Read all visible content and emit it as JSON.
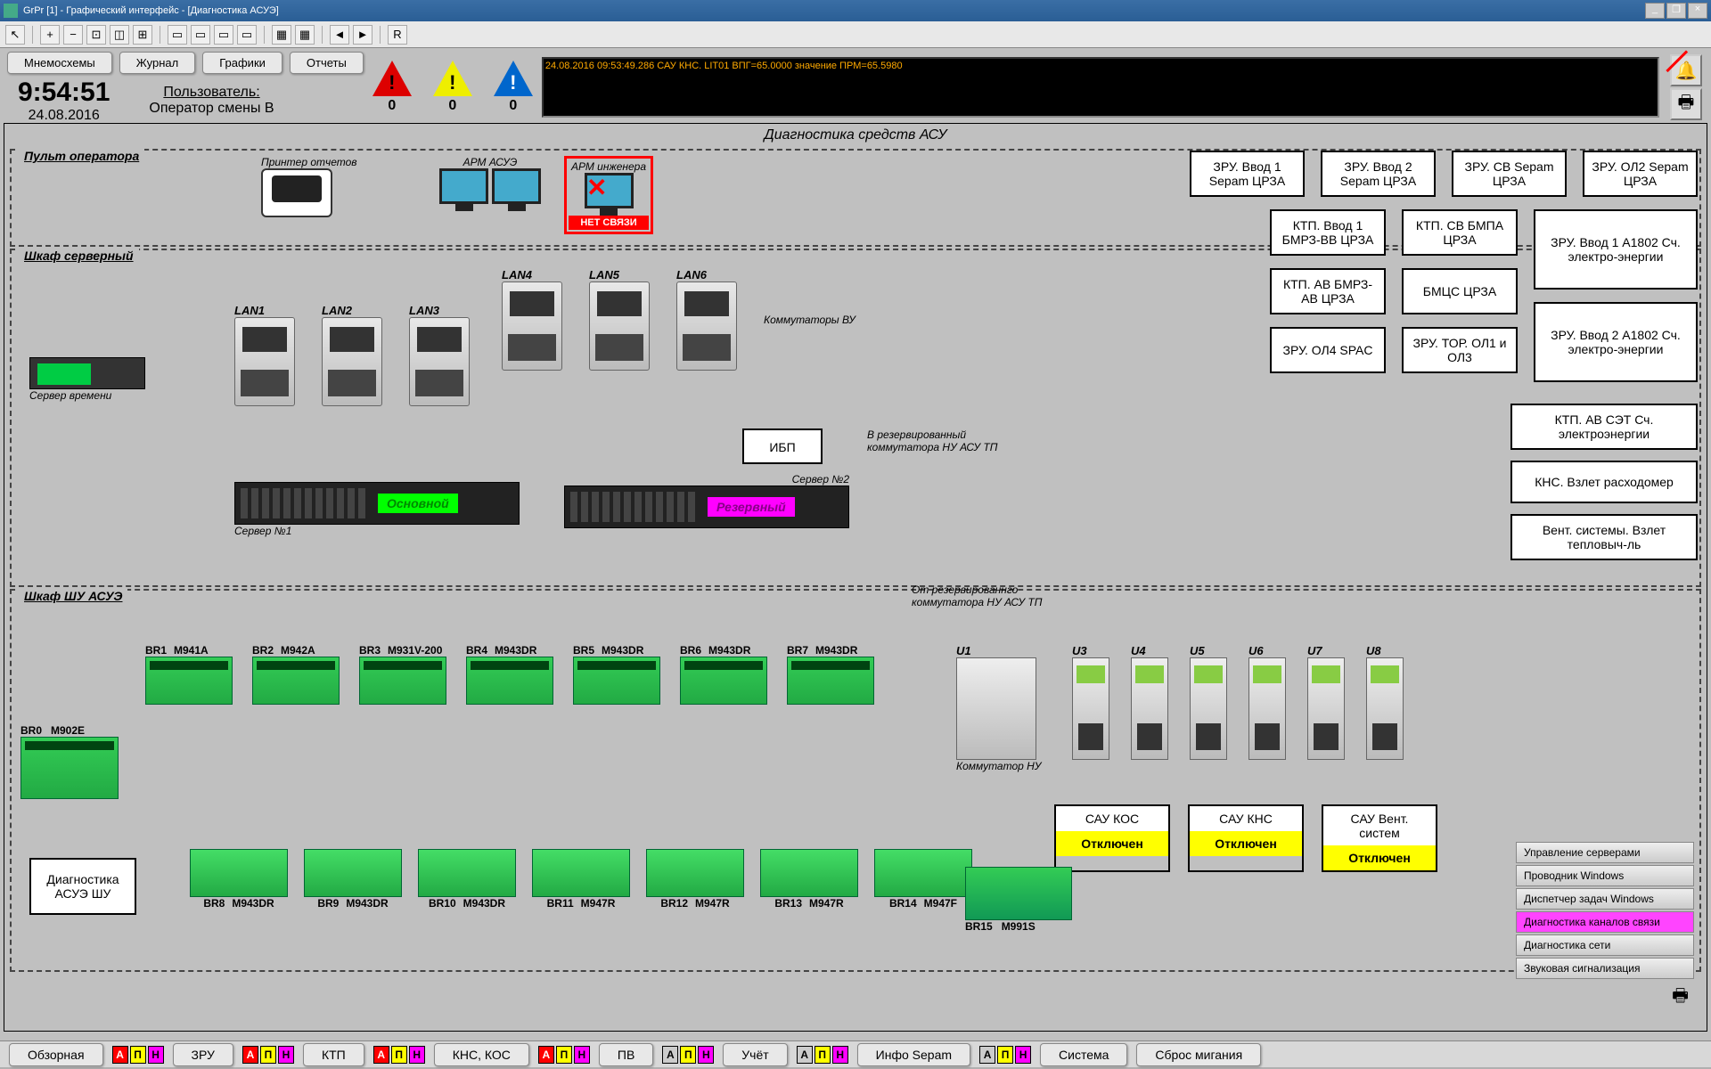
{
  "window": {
    "title": "GrPr [1] - Графический интерфейс - [Диагностика АСУЭ]"
  },
  "toolbar": {
    "cursor": "↖",
    "zoom_in": "🔍",
    "zoom_out": "🔍",
    "zoom_fit": "⊡",
    "zoom_100": "1:1",
    "refresh": "R"
  },
  "nav": {
    "mnemo": "Мнемосхемы",
    "journal": "Журнал",
    "graphs": "Графики",
    "reports": "Отчеты"
  },
  "clock": {
    "time": "9:54:51",
    "date": "24.08.2016"
  },
  "user": {
    "label": "Пользователь:",
    "value": "Оператор смены В"
  },
  "alarms": {
    "red": 0,
    "yellow": 0,
    "blue": 0
  },
  "msg": {
    "line": "24.08.2016 09:53:49.286    САУ КНС. LIT01                                               ВПГ=65.0000  значение ПРМ=65.5980"
  },
  "diag": {
    "title": "Диагностика средств АСУ",
    "p1": {
      "title": "Пульт оператора",
      "printer": "Принтер отчетов",
      "arm1": "АРМ АСУЭ",
      "arm2": "АРМ инженера",
      "nolink": "НЕТ СВЯЗИ"
    },
    "p2": {
      "title": "Шкаф серверный",
      "lan": [
        "LAN1",
        "LAN2",
        "LAN3",
        "LAN4",
        "LAN5",
        "LAN6"
      ],
      "komm_vu": "Коммутаторы ВУ",
      "timesrv": "Сервер времени",
      "srv1": "Сервер №1",
      "srv1s": "Основной",
      "srv2": "Сервер №2",
      "srv2s": "Резервный",
      "ibp": "ИБП",
      "reserve": "В резервированный коммутатора НУ АСУ ТП"
    },
    "p3": {
      "title": "Шкаф ШУ АСУЭ",
      "from_reserve": "От резервированнго коммутатора НУ АСУ ТП",
      "br0": {
        "id": "BR0",
        "model": "M902E"
      },
      "top": [
        {
          "id": "BR1",
          "model": "M941A"
        },
        {
          "id": "BR2",
          "model": "M942A"
        },
        {
          "id": "BR3",
          "model": "M931V-200"
        },
        {
          "id": "BR4",
          "model": "M943DR"
        },
        {
          "id": "BR5",
          "model": "M943DR"
        },
        {
          "id": "BR6",
          "model": "M943DR"
        },
        {
          "id": "BR7",
          "model": "M943DR"
        }
      ],
      "bot": [
        {
          "id": "BR8",
          "model": "M943DR"
        },
        {
          "id": "BR9",
          "model": "M943DR"
        },
        {
          "id": "BR10",
          "model": "M943DR"
        },
        {
          "id": "BR11",
          "model": "M947R"
        },
        {
          "id": "BR12",
          "model": "M947R"
        },
        {
          "id": "BR13",
          "model": "M947R"
        },
        {
          "id": "BR14",
          "model": "M947F"
        }
      ],
      "br15": {
        "id": "BR15",
        "model": "M991S"
      },
      "diagbtn": "Диагностика АСУЭ ШУ",
      "u": [
        "U1",
        "U3",
        "U4",
        "U5",
        "U6",
        "U7",
        "U8"
      ],
      "komm_nu": "Коммутатор НУ",
      "sau": [
        {
          "t": "САУ КОС",
          "b": "Отключен"
        },
        {
          "t": "САУ КНС",
          "b": "Отключен"
        },
        {
          "t": "САУ Вент. систем",
          "b": "Отключен"
        }
      ]
    },
    "right": {
      "r1": [
        "ЗРУ. Ввод 1 Sepam ЦРЗА",
        "ЗРУ. Ввод 2 Sepam ЦРЗА",
        "ЗРУ. СВ Sepam ЦРЗА",
        "ЗРУ. ОЛ2 Sepam ЦРЗА"
      ],
      "r2a": [
        "КТП. Ввод 1 БМРЗ-ВВ ЦРЗА",
        "КТП. СВ БМПА ЦРЗА"
      ],
      "r2b": "ЗРУ. Ввод 1 А1802 Сч. электро-энергии",
      "r3a": [
        "КТП. АВ БМРЗ-АВ ЦРЗА",
        "БМЦС ЦРЗА"
      ],
      "r3b": "ЗРУ. Ввод 2 А1802 Сч. электро-энергии",
      "r4": [
        "ЗРУ. ОЛ4 SPAC",
        "ЗРУ. ТОР. ОЛ1 и ОЛ3"
      ],
      "r5": [
        "КТП. АВ СЭТ Сч. электроэнергии",
        "КНС. Взлет расходомер",
        "Вент. системы. Взлет тепловыч-ль"
      ]
    },
    "menu": [
      "Управление серверами",
      "Проводник Windows",
      "Диспетчер задач Windows",
      "Диагностика каналов связи",
      "Диагностика сети",
      "Звуковая сигнализация"
    ]
  },
  "footer": {
    "btns": [
      "Обзорная",
      "ЗРУ",
      "КТП",
      "КНС, КОС",
      "ПВ",
      "Учёт",
      "Инфо Sepam",
      "Система",
      "Сброс мигания"
    ]
  }
}
